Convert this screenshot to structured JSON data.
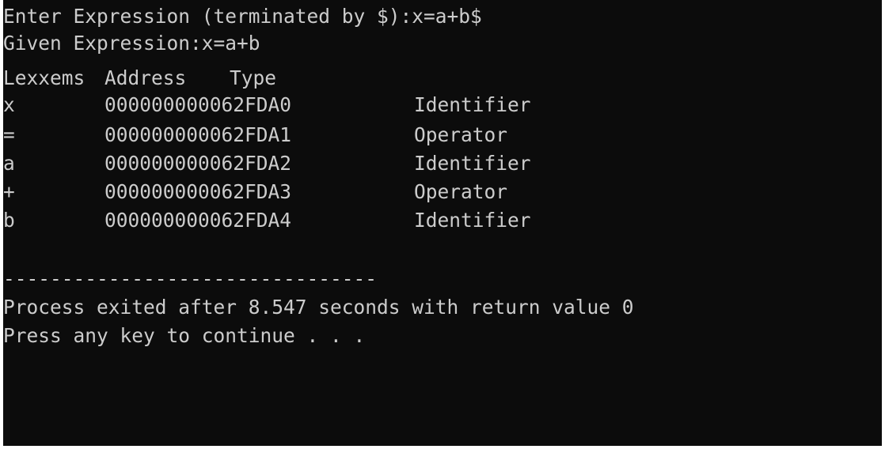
{
  "console": {
    "prompt_label": "Enter Expression (terminated by $):",
    "prompt_input": "x=a+b$",
    "given_line": "Given Expression:x=a+b",
    "table": {
      "headers": [
        "Lexxems",
        "Address",
        "Type"
      ],
      "rows": [
        {
          "lexeme": "x",
          "address": "000000000062FDA0",
          "type": "Identifier"
        },
        {
          "lexeme": "=",
          "address": "000000000062FDA1",
          "type": "Operator"
        },
        {
          "lexeme": "a",
          "address": "000000000062FDA2",
          "type": "Identifier"
        },
        {
          "lexeme": "+",
          "address": "000000000062FDA3",
          "type": "Operator"
        },
        {
          "lexeme": "b",
          "address": "000000000062FDA4",
          "type": "Identifier"
        }
      ]
    },
    "separator": "--------------------------------",
    "exit_message": "Process exited after 8.547 seconds with return value 0",
    "continue_prompt": "Press any key to continue . . ."
  },
  "colors": {
    "background": "#0c0c0c",
    "text": "#cccccc"
  }
}
